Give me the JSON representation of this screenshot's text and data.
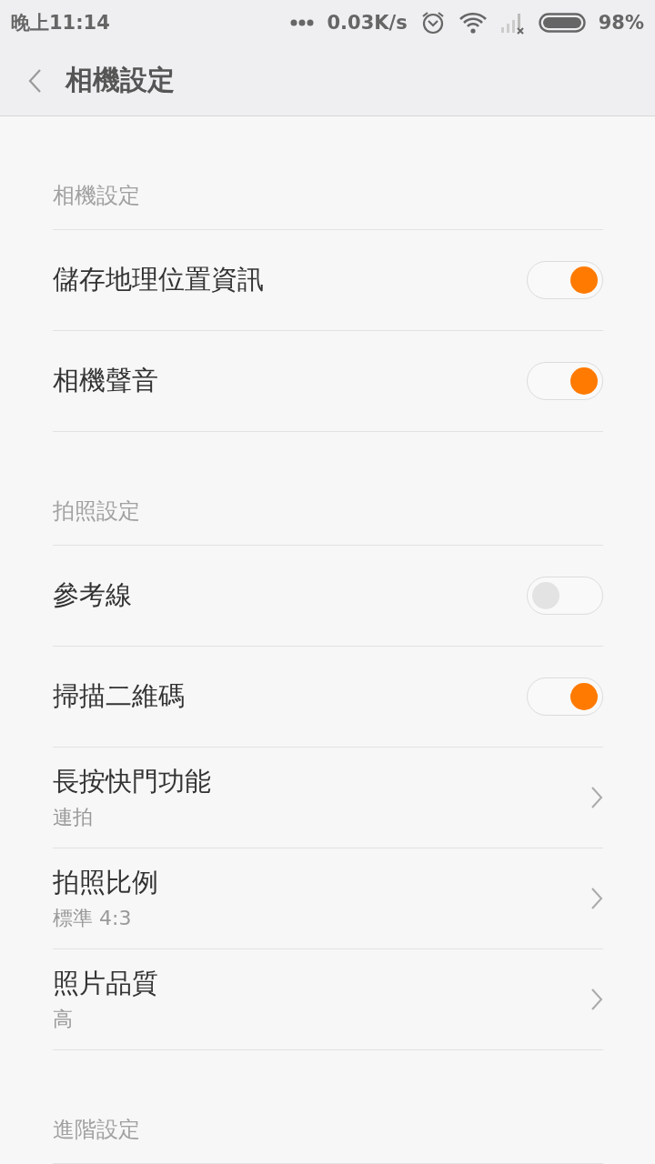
{
  "status_bar": {
    "time": "晚上11:14",
    "speed": "0.03K/s",
    "battery": "98%"
  },
  "header": {
    "title": "相機設定"
  },
  "sections": [
    {
      "title": "相機設定",
      "items": [
        {
          "kind": "toggle",
          "label": "儲存地理位置資訊",
          "on": true
        },
        {
          "kind": "toggle",
          "label": "相機聲音",
          "on": true
        }
      ]
    },
    {
      "title": "拍照設定",
      "items": [
        {
          "kind": "toggle",
          "label": "參考線",
          "on": false
        },
        {
          "kind": "toggle",
          "label": "掃描二維碼",
          "on": true
        },
        {
          "kind": "link",
          "label": "長按快門功能",
          "value": "連拍"
        },
        {
          "kind": "link",
          "label": "拍照比例",
          "value": "標準 4:3"
        },
        {
          "kind": "link",
          "label": "照片品質",
          "value": "高"
        }
      ]
    },
    {
      "title": "進階設定"
    }
  ]
}
